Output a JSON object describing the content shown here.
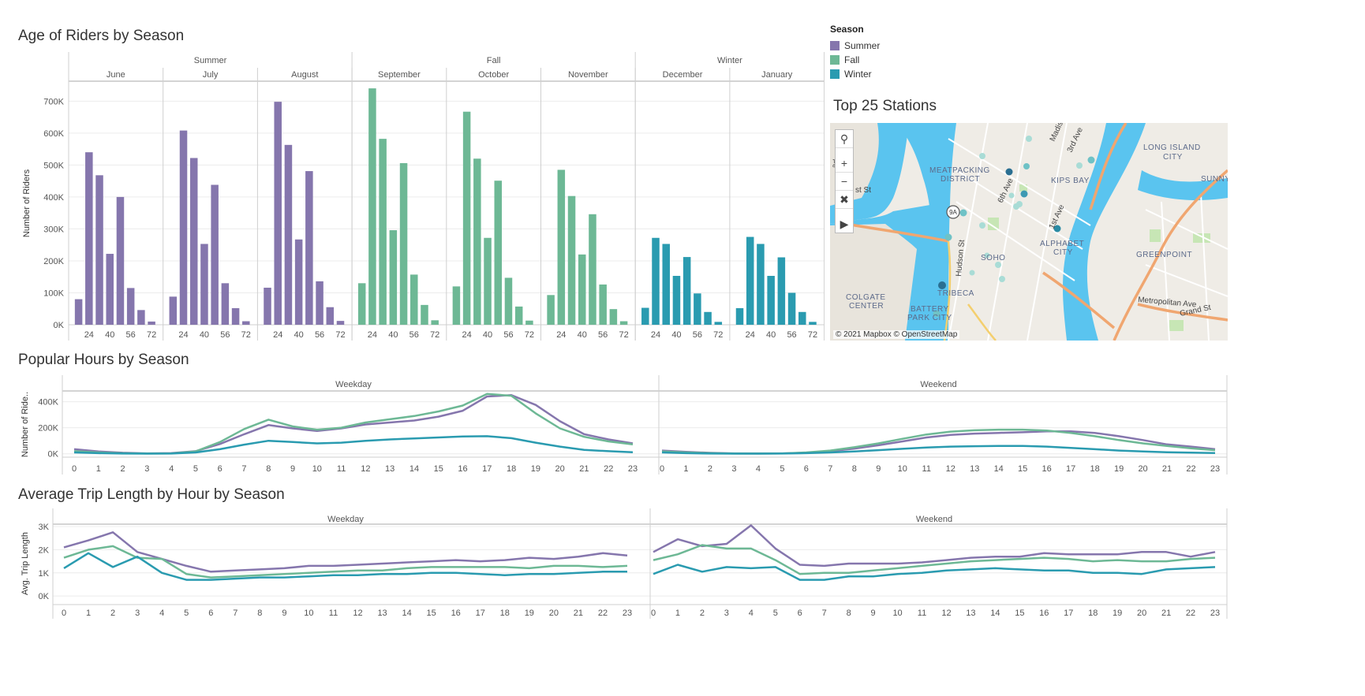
{
  "colors": {
    "Summer": "#8576ad",
    "Fall": "#6db895",
    "Winter": "#2a9bb0",
    "grid": "#ececec",
    "axis": "#cfcfcf",
    "text": "#555555"
  },
  "age_chart": {
    "title": "Age of Riders by Season",
    "ylabel": "Number of Riders"
  },
  "legend": {
    "title": "Season",
    "items": [
      {
        "label": "Summer",
        "color": "#8576ad"
      },
      {
        "label": "Fall",
        "color": "#6db895"
      },
      {
        "label": "Winter",
        "color": "#2a9bb0"
      }
    ]
  },
  "map": {
    "title": "Top 25 Stations",
    "attribution": "© 2021 Mapbox © OpenStreetMap",
    "place_labels": [
      "MEATPACKING",
      "DISTRICT",
      "KIPS BAY",
      "LONG ISLAND",
      "CITY",
      "SUNNYS",
      "ALPHABET",
      "CITY",
      "GREENPOINT",
      "SOHO",
      "TRIBECA",
      "COLGATE",
      "CENTER",
      "BATTERY",
      "PARK CITY"
    ],
    "street_labels": [
      "6th Ave",
      "1st Ave",
      "Hudson St",
      "3rd Ave",
      "Madis",
      "Metropolitan Ave",
      "Grand St",
      "st St",
      "ade A",
      "9A"
    ],
    "tools": [
      "search-icon",
      "zoom-in-icon",
      "zoom-out-icon",
      "pin-off-icon",
      "play-icon"
    ]
  },
  "hours_chart": {
    "title": "Popular Hours by Season",
    "ylabel": "Number of Ride.."
  },
  "trip_chart": {
    "title": "Average Trip Length by Hour by Season",
    "ylabel": "Avg. Trip Length"
  },
  "chart_data": [
    {
      "type": "bar",
      "title": "Age of Riders by Season",
      "ylabel": "Number of Riders",
      "ylim": [
        0,
        760000
      ],
      "yticks": [
        0,
        100000,
        200000,
        300000,
        400000,
        500000,
        600000,
        700000
      ],
      "ytick_labels": [
        "0K",
        "100K",
        "200K",
        "300K",
        "400K",
        "500K",
        "600K",
        "700K"
      ],
      "xticks": [
        24,
        40,
        56,
        72
      ],
      "age_bins": [
        16,
        24,
        32,
        40,
        48,
        56,
        64,
        72
      ],
      "season_groups": [
        {
          "name": "Summer",
          "months": [
            "June",
            "July",
            "August"
          ]
        },
        {
          "name": "Fall",
          "months": [
            "September",
            "October",
            "November"
          ]
        },
        {
          "name": "Winter",
          "months": [
            "December",
            "January"
          ]
        }
      ],
      "panels": [
        {
          "month": "June",
          "season": "Summer",
          "values": [
            80000,
            540000,
            468000,
            222000,
            400000,
            115000,
            46000,
            10000
          ]
        },
        {
          "month": "July",
          "season": "Summer",
          "values": [
            88000,
            608000,
            522000,
            253000,
            438000,
            130000,
            52000,
            11000
          ]
        },
        {
          "month": "August",
          "season": "Summer",
          "values": [
            116000,
            698000,
            563000,
            267000,
            481000,
            136000,
            55000,
            12000
          ]
        },
        {
          "month": "September",
          "season": "Fall",
          "values": [
            130000,
            740000,
            582000,
            296000,
            506000,
            157000,
            62000,
            14000
          ]
        },
        {
          "month": "October",
          "season": "Fall",
          "values": [
            120000,
            667000,
            520000,
            272000,
            451000,
            147000,
            57000,
            13000
          ]
        },
        {
          "month": "November",
          "season": "Fall",
          "values": [
            93000,
            485000,
            403000,
            220000,
            346000,
            126000,
            49000,
            11000
          ]
        },
        {
          "month": "December",
          "season": "Winter",
          "values": [
            53000,
            272000,
            253000,
            153000,
            212000,
            98000,
            40000,
            9000
          ]
        },
        {
          "month": "January",
          "season": "Winter",
          "values": [
            52000,
            275000,
            253000,
            153000,
            211000,
            100000,
            40000,
            9000
          ]
        }
      ]
    },
    {
      "type": "line",
      "title": "Popular Hours by Season",
      "ylabel": "Number of Ride..",
      "ylim": [
        -20000,
        470000
      ],
      "yticks": [
        0,
        200000,
        400000
      ],
      "ytick_labels": [
        "0K",
        "200K",
        "400K"
      ],
      "panels": [
        "Weekday",
        "Weekend"
      ],
      "x": [
        0,
        1,
        2,
        3,
        4,
        5,
        6,
        7,
        8,
        9,
        10,
        11,
        12,
        13,
        14,
        15,
        16,
        17,
        18,
        19,
        20,
        21,
        22,
        23
      ],
      "series": [
        {
          "name": "Summer",
          "weekday": [
            35000,
            18000,
            8000,
            3000,
            5000,
            20000,
            75000,
            150000,
            220000,
            195000,
            175000,
            195000,
            225000,
            240000,
            255000,
            285000,
            330000,
            440000,
            450000,
            375000,
            250000,
            150000,
            110000,
            80000
          ],
          "weekend": [
            25000,
            15000,
            7000,
            3000,
            2000,
            3000,
            8000,
            20000,
            40000,
            65000,
            95000,
            125000,
            145000,
            155000,
            160000,
            165000,
            172000,
            172000,
            160000,
            135000,
            105000,
            72000,
            55000,
            35000
          ]
        },
        {
          "name": "Fall",
          "weekday": [
            20000,
            10000,
            4000,
            2000,
            3000,
            18000,
            90000,
            190000,
            262000,
            210000,
            185000,
            200000,
            240000,
            265000,
            290000,
            325000,
            370000,
            460000,
            445000,
            310000,
            195000,
            130000,
            95000,
            72000
          ],
          "weekend": [
            18000,
            10000,
            5000,
            2000,
            2000,
            3000,
            10000,
            25000,
            50000,
            80000,
            115000,
            148000,
            170000,
            180000,
            185000,
            185000,
            178000,
            160000,
            135000,
            105000,
            80000,
            60000,
            42000,
            28000
          ]
        },
        {
          "name": "Winter",
          "weekday": [
            10000,
            5000,
            2000,
            1000,
            2000,
            10000,
            35000,
            70000,
            100000,
            90000,
            80000,
            85000,
            100000,
            110000,
            118000,
            125000,
            133000,
            135000,
            120000,
            85000,
            55000,
            30000,
            20000,
            12000
          ],
          "weekend": [
            10000,
            5000,
            2000,
            1000,
            1000,
            2000,
            5000,
            10000,
            18000,
            28000,
            38000,
            48000,
            55000,
            58000,
            60000,
            60000,
            55000,
            45000,
            35000,
            25000,
            18000,
            12000,
            9000,
            6000
          ]
        }
      ]
    },
    {
      "type": "line",
      "title": "Average Trip Length by Hour by Season",
      "ylabel": "Avg. Trip Length",
      "ylim": [
        -300,
        3100
      ],
      "yticks": [
        0,
        1000,
        2000,
        3000
      ],
      "ytick_labels": [
        "0K",
        "1K",
        "2K",
        "3K"
      ],
      "panels": [
        "Weekday",
        "Weekend"
      ],
      "x": [
        0,
        1,
        2,
        3,
        4,
        5,
        6,
        7,
        8,
        9,
        10,
        11,
        12,
        13,
        14,
        15,
        16,
        17,
        18,
        19,
        20,
        21,
        22,
        23
      ],
      "series": [
        {
          "name": "Summer",
          "weekday": [
            2100,
            2400,
            2750,
            1900,
            1600,
            1300,
            1050,
            1100,
            1150,
            1200,
            1300,
            1300,
            1350,
            1400,
            1450,
            1500,
            1550,
            1500,
            1550,
            1650,
            1600,
            1700,
            1850,
            1750
          ],
          "weekend": [
            1900,
            2450,
            2150,
            2250,
            3050,
            2050,
            1350,
            1300,
            1400,
            1400,
            1400,
            1450,
            1550,
            1650,
            1700,
            1700,
            1850,
            1800,
            1800,
            1800,
            1900,
            1900,
            1700,
            1900
          ]
        },
        {
          "name": "Fall",
          "weekday": [
            1650,
            2000,
            2150,
            1650,
            1600,
            950,
            800,
            850,
            900,
            950,
            1000,
            1050,
            1100,
            1100,
            1200,
            1250,
            1250,
            1250,
            1250,
            1200,
            1300,
            1300,
            1250,
            1300
          ],
          "weekend": [
            1550,
            1800,
            2200,
            2050,
            2050,
            1550,
            950,
            1000,
            1000,
            1100,
            1200,
            1300,
            1400,
            1500,
            1550,
            1600,
            1650,
            1600,
            1500,
            1550,
            1500,
            1500,
            1600,
            1650
          ]
        },
        {
          "name": "Winter",
          "weekday": [
            1200,
            1850,
            1250,
            1700,
            1000,
            700,
            700,
            750,
            800,
            800,
            850,
            900,
            900,
            950,
            950,
            1000,
            1000,
            950,
            900,
            950,
            950,
            1000,
            1050,
            1050
          ],
          "weekend": [
            950,
            1350,
            1050,
            1250,
            1200,
            1250,
            700,
            700,
            850,
            850,
            950,
            1000,
            1100,
            1150,
            1200,
            1150,
            1100,
            1100,
            1000,
            1000,
            950,
            1150,
            1200,
            1250
          ]
        }
      ]
    }
  ]
}
